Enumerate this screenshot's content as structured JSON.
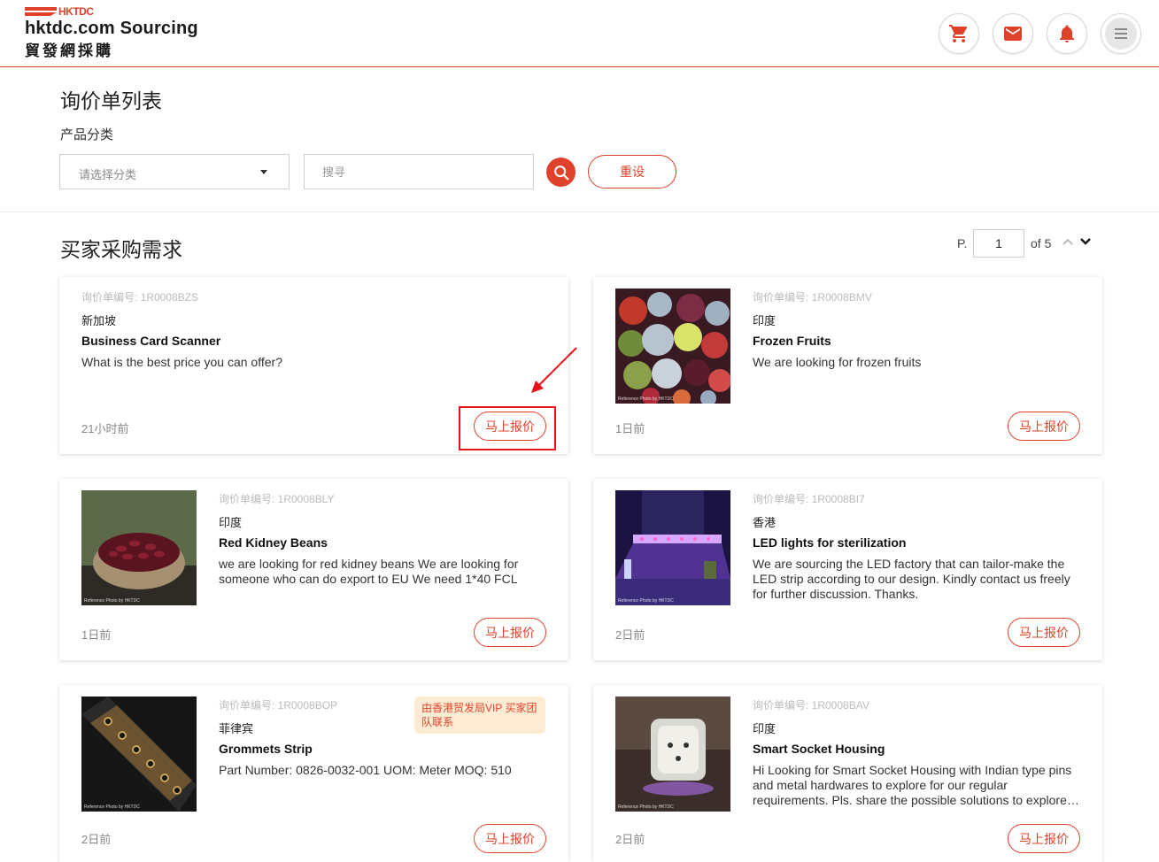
{
  "header": {
    "logo_tag": "HKTDC",
    "logo_title": "hktdc.com Sourcing",
    "logo_subtitle": "貿發網採購"
  },
  "page": {
    "title": "询价单列表",
    "category_label": "产品分类",
    "category_placeholder": "请选择分类",
    "search_placeholder": "搜寻",
    "reset_label": "重设"
  },
  "section": {
    "title": "买家采购需求",
    "pager_prefix": "P.",
    "pager_value": "1",
    "pager_total": "of 5"
  },
  "colors": {
    "accent": "#e0412a"
  },
  "cards": [
    {
      "id_label": "询价单编号: 1R0008BZS",
      "country": "新加坡",
      "title": "Business Card Scanner",
      "desc": "What is the best price you can offer?",
      "time": "21小时前",
      "cta": "马上报价"
    },
    {
      "id_label": "询价单编号: 1R0008BMV",
      "country": "印度",
      "title": "Frozen Fruits",
      "desc": "We are looking for frozen fruits",
      "time": "1日前",
      "cta": "马上报价",
      "photo_credit": "Reference Photo by HKTDC"
    },
    {
      "id_label": "询价单编号: 1R0008BLY",
      "country": "印度",
      "title": "Red Kidney Beans",
      "desc": "we are looking for red kidney beans We are looking for someone who can do export to EU We need 1*40 FCL",
      "time": "1日前",
      "cta": "马上报价",
      "photo_credit": "Reference Photo by HKTDC"
    },
    {
      "id_label": "询价单编号: 1R0008BI7",
      "country": "香港",
      "title": "LED lights for sterilization",
      "desc": "We are sourcing the LED factory that can tailor-make the LED strip according to our design. Kindly contact us freely for further discussion. Thanks.",
      "time": "2日前",
      "cta": "马上报价",
      "photo_credit": "Reference Photo by HKTDC"
    },
    {
      "id_label": "询价单编号: 1R0008BOP",
      "country": "菲律宾",
      "title": "Grommets Strip",
      "desc": "Part Number: 0826-0032-001 UOM: Meter MOQ: 510",
      "time": "2日前",
      "cta": "马上报价",
      "vip": "由香港贸发局VIP 买家团队联系",
      "photo_credit": "Reference Photo by HKTDC"
    },
    {
      "id_label": "询价单编号: 1R0008BAV",
      "country": "印度",
      "title": "Smart Socket Housing",
      "desc": "Hi Looking for Smart Socket Housing with Indian type pins and metal hardwares to explore for our regular requirements. Pls. share the possible solutions to explore…",
      "time": "2日前",
      "cta": "马上报价",
      "photo_credit": "Reference Photo by HKTDC"
    }
  ]
}
